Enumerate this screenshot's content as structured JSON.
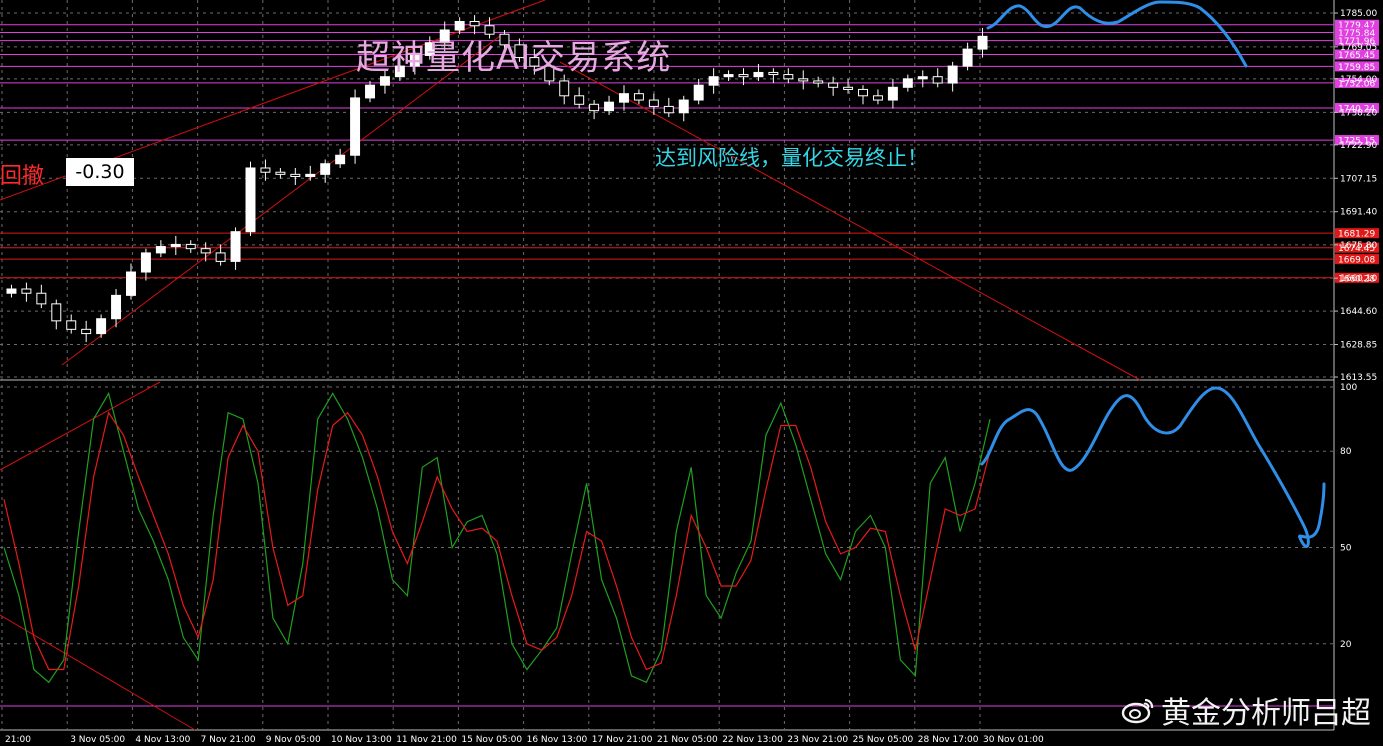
{
  "overlay": {
    "title": "超神量化AI交易系统",
    "risk_note": "达到风险线，量化交易终止！",
    "left_label": "回撤",
    "value_box": "-0.30",
    "watermark": "黄金分析师吕超"
  },
  "colors": {
    "background": "#000000",
    "grid": "#6b6b6b",
    "bull_candle": "#ffffff",
    "bear_candle": "#000000",
    "wick": "#ffffff",
    "level_magenta": "#e040e0",
    "level_red": "#e01818",
    "trend_red": "#d01010",
    "k_line": "#1fa01f",
    "d_line": "#e81a1a",
    "hand_drawn": "#2f8fe8"
  },
  "chart_data": [
    {
      "type": "candlestick",
      "y_ticks": [
        "1785.00",
        "1769.05",
        "1754.00",
        "1738.20",
        "1722.90",
        "1707.15",
        "1691.40",
        "1675.80",
        "1660.10",
        "1644.60",
        "1628.85",
        "1613.55"
      ],
      "ylim": [
        1613.55,
        1785.0
      ],
      "x_ticks": [
        "21:00",
        "3 Nov 05:00",
        "4 Nov 13:00",
        "7 Nov 21:00",
        "9 Nov 05:00",
        "10 Nov 13:00",
        "11 Nov 21:00",
        "15 Nov 05:00",
        "16 Nov 13:00",
        "17 Nov 21:00",
        "21 Nov 05:00",
        "22 Nov 13:00",
        "23 Nov 21:00",
        "25 Nov 05:00",
        "28 Nov 17:00",
        "30 Nov 01:00"
      ],
      "levels_magenta": [
        "1779.47",
        "1775.84",
        "1771.96",
        "1765.45",
        "1759.85",
        "1752.06",
        "1740.24",
        "1725.15"
      ],
      "levels_red": [
        "1681.29",
        "1674.45",
        "1669.08",
        "1660.28"
      ],
      "close_path": [
        1655,
        1653,
        1648,
        1640,
        1636,
        1634,
        1641,
        1652,
        1663,
        1672,
        1675,
        1676,
        1674,
        1672,
        1668,
        1682,
        1712,
        1710,
        1709,
        1708,
        1709,
        1714,
        1718,
        1745,
        1751,
        1755,
        1760,
        1765,
        1771,
        1777,
        1781,
        1779,
        1775,
        1770,
        1764,
        1760,
        1753,
        1746,
        1742,
        1739,
        1743,
        1747,
        1744,
        1741,
        1738,
        1744,
        1751,
        1755,
        1756,
        1755,
        1757,
        1756,
        1754,
        1753,
        1752,
        1750,
        1749,
        1746,
        1744,
        1750,
        1754,
        1755,
        1752,
        1760,
        1768,
        1774
      ]
    },
    {
      "type": "line",
      "name": "stochastic",
      "y_ticks": [
        "100",
        "80",
        "50",
        "20"
      ],
      "ylim": [
        0,
        100
      ],
      "series": [
        {
          "key": "K",
          "values": [
            50,
            35,
            12,
            8,
            15,
            55,
            90,
            98,
            80,
            62,
            52,
            40,
            22,
            15,
            60,
            92,
            90,
            70,
            28,
            20,
            45,
            90,
            98,
            90,
            78,
            62,
            40,
            35,
            75,
            78,
            50,
            58,
            60,
            48,
            20,
            12,
            18,
            25,
            48,
            70,
            40,
            28,
            10,
            8,
            18,
            55,
            75,
            35,
            28,
            42,
            52,
            85,
            95,
            82,
            65,
            48,
            40,
            55,
            60,
            50,
            15,
            10,
            70,
            78,
            55,
            70,
            90
          ]
        },
        {
          "key": "D",
          "values": [
            65,
            45,
            22,
            12,
            12,
            38,
            72,
            92,
            85,
            72,
            60,
            48,
            32,
            22,
            40,
            78,
            88,
            80,
            50,
            32,
            35,
            68,
            88,
            92,
            85,
            72,
            55,
            45,
            58,
            72,
            62,
            55,
            56,
            52,
            35,
            20,
            18,
            22,
            35,
            55,
            52,
            38,
            22,
            12,
            14,
            35,
            60,
            50,
            38,
            38,
            46,
            68,
            88,
            88,
            75,
            58,
            48,
            50,
            56,
            55,
            35,
            18,
            40,
            62,
            60,
            62,
            80
          ]
        }
      ]
    }
  ]
}
